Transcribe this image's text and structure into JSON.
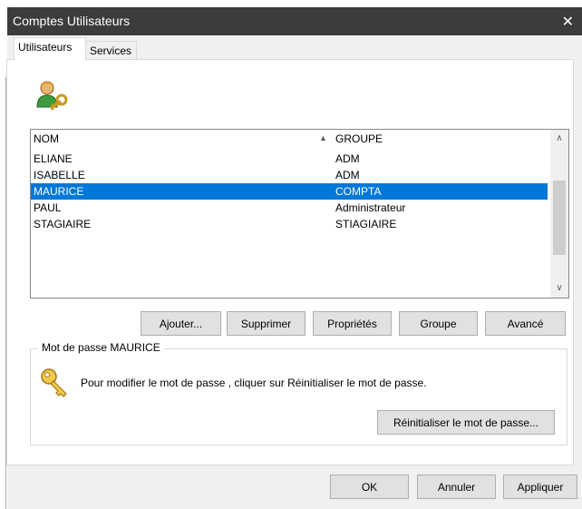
{
  "window": {
    "title": "Comptes Utilisateurs",
    "close_glyph": "✕"
  },
  "tabs": [
    {
      "label": "Utilisateurs",
      "active": true
    },
    {
      "label": "Services",
      "active": false
    }
  ],
  "icons": {
    "users": "user-key-icon",
    "password": "key-icon"
  },
  "list": {
    "columns": [
      "NOM",
      "GROUPE"
    ],
    "sort_indicator": "▲",
    "rows": [
      {
        "name": "ELIANE",
        "group": "ADM",
        "selected": false
      },
      {
        "name": "ISABELLE",
        "group": "ADM",
        "selected": false
      },
      {
        "name": "MAURICE",
        "group": "COMPTA",
        "selected": true
      },
      {
        "name": "PAUL",
        "group": "Administrateur",
        "selected": false
      },
      {
        "name": "STAGIAIRE",
        "group": "STIAGIAIRE",
        "selected": false
      }
    ],
    "scroll_up": "∧",
    "scroll_down": "∨"
  },
  "actions": {
    "add": "Ajouter...",
    "delete": "Supprimer",
    "properties": "Propriétés",
    "group": "Groupe",
    "advanced": "Avancé"
  },
  "password": {
    "group_label": "Mot de passe MAURICE",
    "info": "Pour modifier le mot de passe , cliquer sur  Réinitialiser le mot de passe.",
    "reset_button": "Réinitialiser le mot de passe..."
  },
  "footer": {
    "ok": "OK",
    "cancel": "Annuler",
    "apply": "Appliquer"
  },
  "colors": {
    "selection": "#0078d7",
    "titlebar": "#3c3c3c"
  }
}
